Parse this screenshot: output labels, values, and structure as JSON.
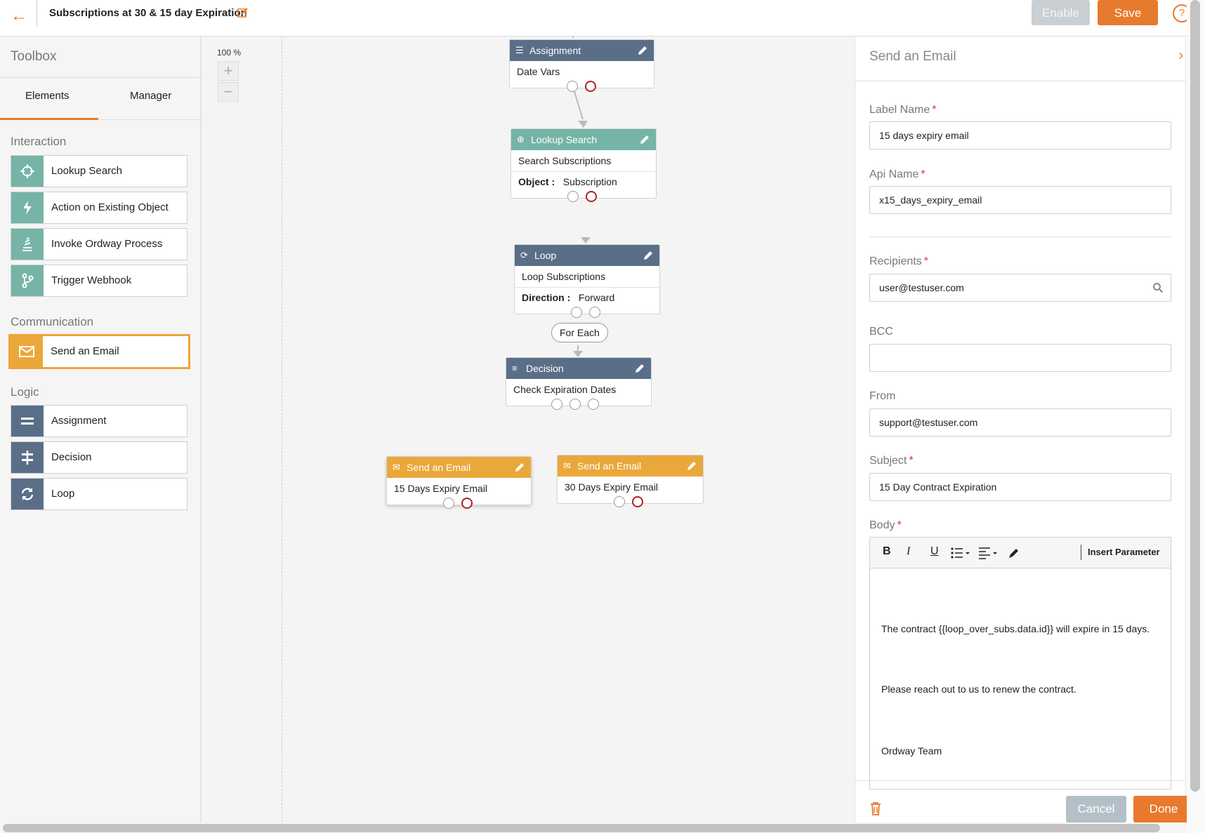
{
  "header": {
    "title": "Subscriptions at 30 & 15 day Expiration",
    "enable_label": "Enable",
    "save_label": "Save",
    "help_glyph": "?"
  },
  "toolbox": {
    "title": "Toolbox",
    "tabs": [
      "Elements",
      "Manager"
    ],
    "active_tab": "Elements",
    "sections": {
      "interaction": {
        "label": "Interaction",
        "items": [
          "Lookup Search",
          "Action on Existing Object",
          "Invoke Ordway Process",
          "Trigger Webhook"
        ]
      },
      "communication": {
        "label": "Communication",
        "items": [
          "Send an Email"
        ]
      },
      "logic": {
        "label": "Logic",
        "items": [
          "Assignment",
          "Decision",
          "Loop"
        ]
      }
    },
    "selected_item": "Send an Email"
  },
  "canvas": {
    "zoom": "100 %",
    "zoom_in": "+",
    "zoom_out": "−",
    "nodes": {
      "assignment": {
        "type": "Assignment",
        "label": "Date Vars"
      },
      "lookup": {
        "type": "Lookup Search",
        "label": "Search Subscriptions",
        "prop_key": "Object :",
        "prop_value": "Subscription"
      },
      "loop": {
        "type": "Loop",
        "label": "Loop Subscriptions",
        "prop_key": "Direction :",
        "prop_value": "Forward"
      },
      "for_each": "For Each",
      "decision": {
        "type": "Decision",
        "label": "Check Expiration Dates"
      },
      "email15": {
        "type": "Send an Email",
        "label": "15 Days Expiry Email"
      },
      "email30": {
        "type": "Send an Email",
        "label": "30 Days Expiry Email"
      }
    }
  },
  "panel": {
    "title": "Send an Email",
    "required_mark": "*",
    "fields": {
      "label_name": {
        "label": "Label Name",
        "value": "15 days expiry email"
      },
      "api_name": {
        "label": "Api Name",
        "value": "x15_days_expiry_email"
      },
      "recipients": {
        "label": "Recipients",
        "value": "user@testuser.com"
      },
      "bcc": {
        "label": "BCC",
        "value": ""
      },
      "from": {
        "label": "From",
        "value": "support@testuser.com"
      },
      "subject": {
        "label": "Subject",
        "value": "15 Day Contract Expiration"
      },
      "body": {
        "label": "Body"
      }
    },
    "editor": {
      "toolbar": {
        "bold": "B",
        "italic": "I",
        "underline": "U",
        "insert_parameter": "Insert Parameter"
      },
      "body_lines": [
        "The contract {{loop_over_subs.data.id}} will expire in 15 days.",
        "Please reach out to us to renew the contract.",
        "Ordway Team"
      ]
    },
    "cancel_label": "Cancel",
    "done_label": "Done"
  },
  "colors": {
    "accent": "#e87a2d",
    "teal": "#75b4a6",
    "slate": "#5a6e87",
    "email": "#eaa83a",
    "required": "#e03535"
  },
  "icons": {
    "back": "arrow-left-icon",
    "title_edit": "edit-icon",
    "help": "help-icon",
    "lookup": "crosshair-icon",
    "action": "lightning-icon",
    "invoke": "process-icon",
    "webhook": "webhook-icon",
    "email": "envelope-icon",
    "assignment": "equals-icon",
    "decision": "decision-icon",
    "loop": "loop-icon",
    "search": "search-icon",
    "delete": "trash-icon"
  }
}
